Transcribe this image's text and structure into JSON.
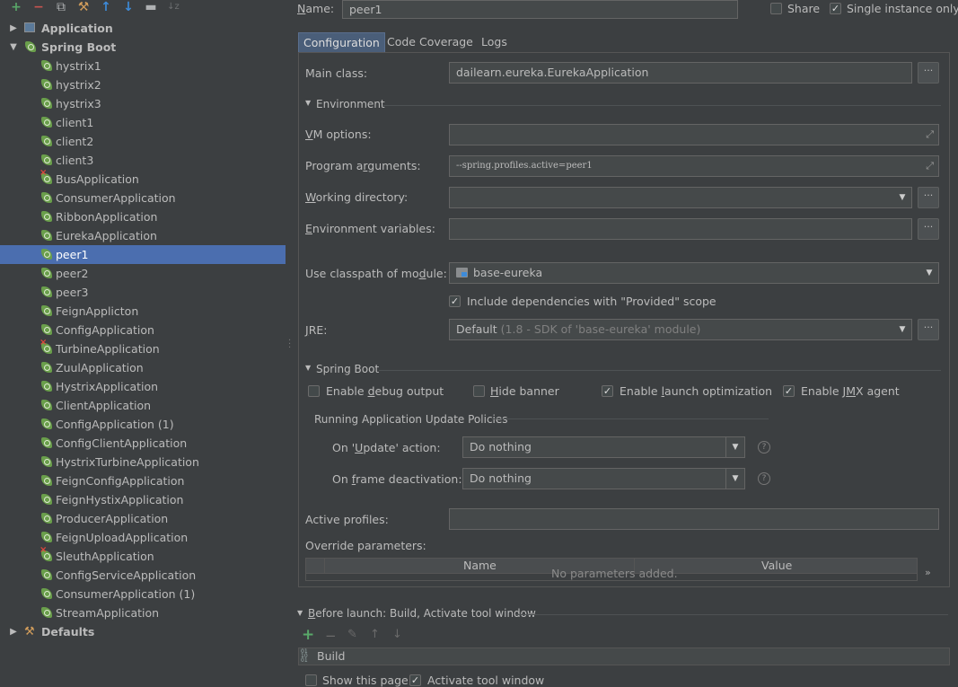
{
  "toolbar": {
    "add": "+",
    "remove": "−",
    "copy": "⧉",
    "wrench": "⚒",
    "up": "↑",
    "down": "↓",
    "folder": "▬",
    "sort": "↓z"
  },
  "tree": {
    "application": "Application",
    "spring_boot": "Spring Boot",
    "defaults": "Defaults",
    "items": [
      {
        "label": "hystrix1",
        "error": false
      },
      {
        "label": "hystrix2",
        "error": false
      },
      {
        "label": "hystrix3",
        "error": false
      },
      {
        "label": "client1",
        "error": false
      },
      {
        "label": "client2",
        "error": false
      },
      {
        "label": "client3",
        "error": false
      },
      {
        "label": "BusApplication",
        "error": true
      },
      {
        "label": "ConsumerApplication",
        "error": false
      },
      {
        "label": "RibbonApplication",
        "error": false
      },
      {
        "label": "EurekaApplication",
        "error": false
      },
      {
        "label": "peer1",
        "error": false,
        "selected": true
      },
      {
        "label": "peer2",
        "error": false
      },
      {
        "label": "peer3",
        "error": false
      },
      {
        "label": "FeignApplicton",
        "error": false
      },
      {
        "label": "ConfigApplication",
        "error": false
      },
      {
        "label": "TurbineApplication",
        "error": true
      },
      {
        "label": "ZuulApplication",
        "error": false
      },
      {
        "label": "HystrixApplication",
        "error": false
      },
      {
        "label": "ClientApplication",
        "error": false
      },
      {
        "label": "ConfigApplication (1)",
        "error": false
      },
      {
        "label": "ConfigClientApplication",
        "error": false
      },
      {
        "label": "HystrixTurbineApplication",
        "error": false
      },
      {
        "label": "FeignConfigApplication",
        "error": false
      },
      {
        "label": "FeignHystixApplication",
        "error": false
      },
      {
        "label": "ProducerApplication",
        "error": false
      },
      {
        "label": "FeignUploadApplication",
        "error": false
      },
      {
        "label": "SleuthApplication",
        "error": true
      },
      {
        "label": "ConfigServiceApplication",
        "error": false
      },
      {
        "label": "ConsumerApplication (1)",
        "error": false
      },
      {
        "label": "StreamApplication",
        "error": false
      }
    ]
  },
  "header": {
    "name_label": "Name:",
    "name_value": "peer1",
    "share_label": "Share",
    "share_checked": false,
    "single_instance_label": "Single instance only",
    "single_instance_checked": true
  },
  "tabs": [
    "Configuration",
    "Code Coverage",
    "Logs"
  ],
  "config": {
    "main_class_label": "Main class:",
    "main_class_value": "dailearn.eureka.EurekaApplication",
    "environment_section": "Environment",
    "vm_options_label": "VM options:",
    "vm_options_value": "",
    "program_args_label": "Program arguments:",
    "program_args_value": "--spring.profiles.active=peer1",
    "working_dir_label": "Working directory:",
    "working_dir_value": "",
    "env_vars_label": "Environment variables:",
    "env_vars_value": "",
    "classpath_label": "Use classpath of module:",
    "classpath_value": "base-eureka",
    "include_deps_label": "Include dependencies with \"Provided\" scope",
    "jre_label": "JRE:",
    "jre_value": "Default",
    "jre_detail": "(1.8 - SDK of 'base-eureka' module)",
    "spring_boot_section": "Spring Boot",
    "debug_output_label": "Enable debug output",
    "hide_banner_label": "Hide banner",
    "launch_opt_label": "Enable launch optimization",
    "jmx_label": "Enable JMX agent",
    "update_policies_section": "Running Application Update Policies",
    "on_update_label": "On 'Update' action:",
    "on_update_value": "Do nothing",
    "on_frame_label": "On frame deactivation:",
    "on_frame_value": "Do nothing",
    "active_profiles_label": "Active profiles:",
    "active_profiles_value": "",
    "override_params_label": "Override parameters:",
    "table_col_name": "Name",
    "table_col_value": "Value",
    "table_empty": "No parameters added."
  },
  "before_launch": {
    "title": "Before launch: Build, Activate tool window",
    "build_item": "Build",
    "show_page_label": "Show this page",
    "activate_label": "Activate tool window"
  },
  "colors": {
    "background": "#3c3f41",
    "selection": "#4b6eaf",
    "spring_green": "#6a9f4b",
    "error_red": "#e0473d",
    "add_green": "#59a869"
  }
}
